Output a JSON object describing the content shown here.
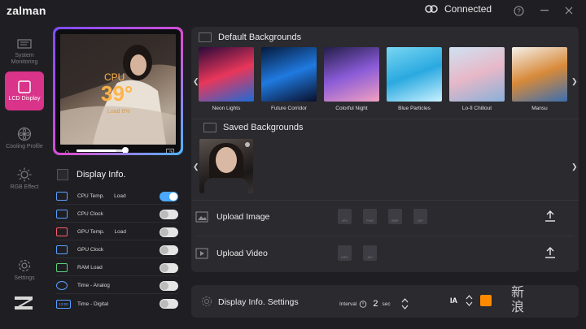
{
  "app": {
    "logo": "zalman",
    "connection_status": "Connected",
    "help_icon": "help-icon",
    "minimize_icon": "minimize-icon",
    "close_icon": "close-icon"
  },
  "sidebar": {
    "items": [
      {
        "label": "System Monitoring",
        "icon": "monitor-icon",
        "active": false
      },
      {
        "label": "LCD Display",
        "icon": "square-icon",
        "active": true
      },
      {
        "label": "Cooling Profile",
        "icon": "fan-icon",
        "active": false
      },
      {
        "label": "RGB Effect",
        "icon": "sun-icon",
        "active": false
      },
      {
        "label": "Settings",
        "icon": "gear-icon",
        "active": false
      }
    ]
  },
  "preview": {
    "cpu_label": "CPU",
    "cpu_temp": "39°",
    "cpu_load": "Load 6%",
    "brightness_level": 0.82
  },
  "display_info": {
    "title": "Display Info.",
    "items": [
      {
        "label": "CPU Temp.",
        "extra": "Load",
        "on": true
      },
      {
        "label": "CPU Clock",
        "extra": "",
        "on": false
      },
      {
        "label": "GPU Temp.",
        "extra": "Load",
        "on": false
      },
      {
        "label": "GPU Clock",
        "extra": "",
        "on": false
      },
      {
        "label": "RAM Load",
        "extra": "",
        "on": false
      },
      {
        "label": "Time - Analog",
        "extra": "",
        "on": false
      },
      {
        "label": "Time - Digital",
        "extra": "",
        "on": false
      }
    ],
    "time_digital_icon_text": "12:00"
  },
  "backgrounds": {
    "default_title": "Default Backgrounds",
    "default_items": [
      {
        "label": "Neon Lights",
        "colors": [
          "#2a0a3a",
          "#e8365a",
          "#1d6bd8"
        ]
      },
      {
        "label": "Future Corridor",
        "colors": [
          "#061a3c",
          "#1f7ae0",
          "#0a0f2a"
        ]
      },
      {
        "label": "Colorful Night",
        "colors": [
          "#241e4a",
          "#8a5bd8",
          "#f2a0c0"
        ]
      },
      {
        "label": "Blue Particles",
        "colors": [
          "#79d6f2",
          "#2aa9e0",
          "#c9f1ff"
        ]
      },
      {
        "label": "Lo-fi Chillout",
        "colors": [
          "#cfe2f2",
          "#e7b8c8",
          "#8ab0d8"
        ]
      },
      {
        "label": "Mansu",
        "colors": [
          "#f4f0ea",
          "#d88a3a",
          "#3a6fb0"
        ]
      }
    ],
    "saved_title": "Saved Backgrounds"
  },
  "upload": {
    "image_label": "Upload Image",
    "image_formats": [
      "JPG",
      "PNG",
      "BMP",
      "GIF"
    ],
    "video_label": "Upload Video",
    "video_formats": [
      "MP4",
      "AVI"
    ]
  },
  "settings": {
    "title": "Display Info. Settings",
    "interval_label": "Interval",
    "interval_value": "2",
    "interval_unit": "sec",
    "font_label": "IA",
    "font_color": "#ff8a00"
  },
  "watermark": "新\n浪"
}
